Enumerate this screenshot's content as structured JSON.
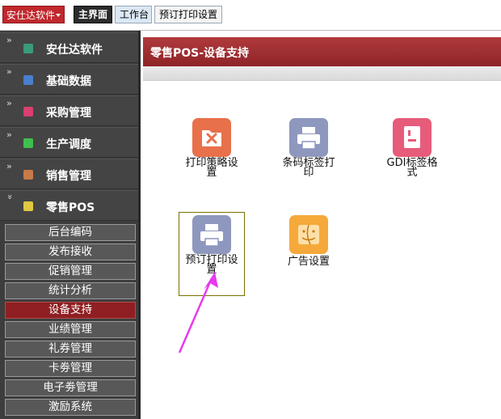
{
  "topbar": {
    "app_menu": "安仕达软件",
    "tabs": [
      "主界面",
      "工作台",
      "预订打印设置"
    ]
  },
  "sidebar": {
    "categories": [
      {
        "label": "安仕达软件",
        "color": "#3a9a7c"
      },
      {
        "label": "基础数据",
        "color": "#4a7fd0"
      },
      {
        "label": "采购管理",
        "color": "#d94070"
      },
      {
        "label": "生产调度",
        "color": "#3fbf4f"
      },
      {
        "label": "销售管理",
        "color": "#c97a4a"
      },
      {
        "label": "零售POS",
        "color": "#e0c840"
      }
    ],
    "subitems": [
      "后台编码",
      "发布接收",
      "促销管理",
      "统计分析",
      "设备支持",
      "业绩管理",
      "礼券管理",
      "卡劵管理",
      "电子劵管理",
      "激励系统"
    ],
    "active_subitem": "设备支持"
  },
  "panel": {
    "title": "零售POS-设备支持",
    "tiles": [
      {
        "label": "打印策略设置",
        "icon": "folder-tools-icon",
        "color": "#e8704a"
      },
      {
        "label": "条码标签打印",
        "icon": "printer-icon",
        "color": "#8e97be"
      },
      {
        "label": "GDI标签格式",
        "icon": "document-icon",
        "color": "#e75c7a"
      },
      {
        "label": "预订打印设置",
        "icon": "printer-icon",
        "color": "#8e97be"
      },
      {
        "label": "广告设置",
        "icon": "finder-icon",
        "color": "#f5a93a"
      }
    ]
  },
  "annotation_color": "#e838f0"
}
